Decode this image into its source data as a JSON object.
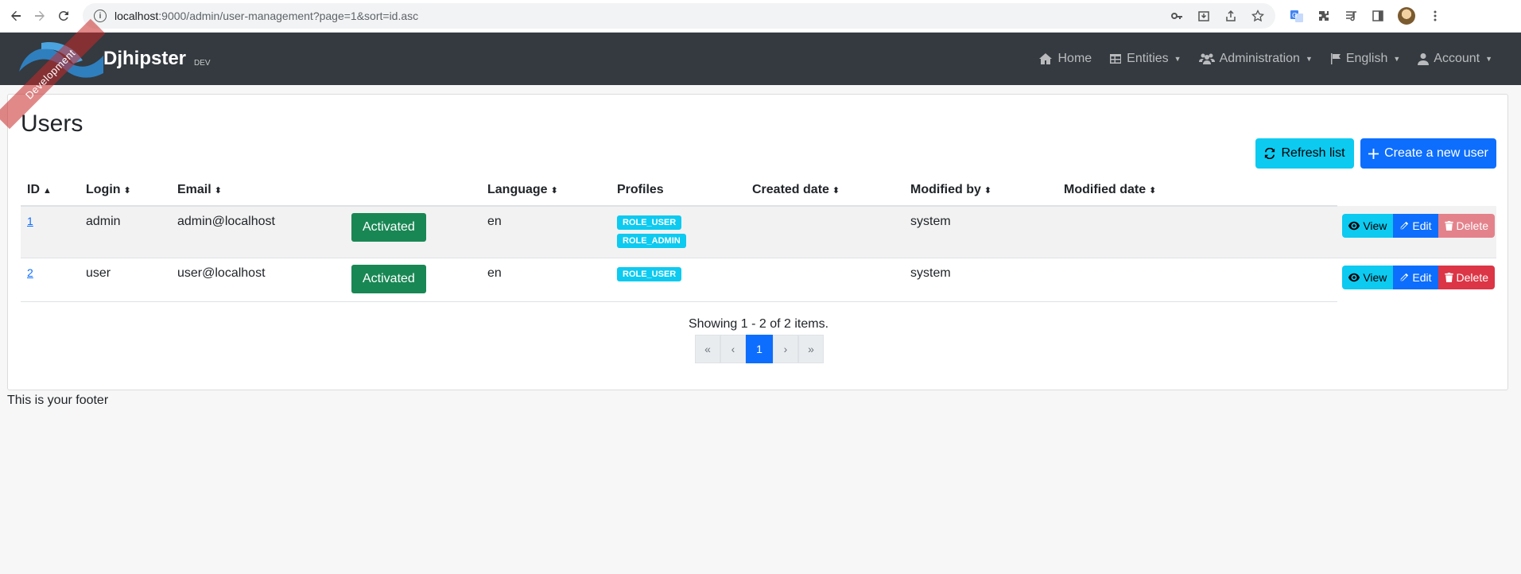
{
  "browser": {
    "url_host": "localhost",
    "url_path": ":9000/admin/user-management?page=1&sort=id.asc"
  },
  "navbar": {
    "brand": "Djhipster",
    "version": "DEV",
    "ribbon": "Development",
    "items": [
      {
        "label": "Home",
        "icon": "home-icon"
      },
      {
        "label": "Entities",
        "icon": "table-icon"
      },
      {
        "label": "Administration",
        "icon": "users-icon"
      },
      {
        "label": "English",
        "icon": "flag-icon"
      },
      {
        "label": "Account",
        "icon": "user-icon"
      }
    ]
  },
  "page": {
    "title": "Users",
    "refresh_label": "Refresh list",
    "create_label": "Create a new user"
  },
  "table": {
    "headers": {
      "id": "ID",
      "login": "Login",
      "email": "Email",
      "language": "Language",
      "profiles": "Profiles",
      "created": "Created date",
      "modified_by": "Modified by",
      "modified_date": "Modified date"
    },
    "rows": [
      {
        "id": "1",
        "login": "admin",
        "email": "admin@localhost",
        "status": "Activated",
        "language": "en",
        "profiles": [
          "ROLE_USER",
          "ROLE_ADMIN"
        ],
        "created": "",
        "modified_by": "system",
        "modified_date": "",
        "view": "View",
        "edit": "Edit",
        "delete": "Delete"
      },
      {
        "id": "2",
        "login": "user",
        "email": "user@localhost",
        "status": "Activated",
        "language": "en",
        "profiles": [
          "ROLE_USER"
        ],
        "created": "",
        "modified_by": "system",
        "modified_date": "",
        "view": "View",
        "edit": "Edit",
        "delete": "Delete"
      }
    ]
  },
  "pagination": {
    "summary": "Showing 1 - 2 of 2 items.",
    "first": "«",
    "prev": "‹",
    "current": "1",
    "next": "›",
    "last": "»"
  },
  "footer": {
    "text": "This is your footer"
  }
}
